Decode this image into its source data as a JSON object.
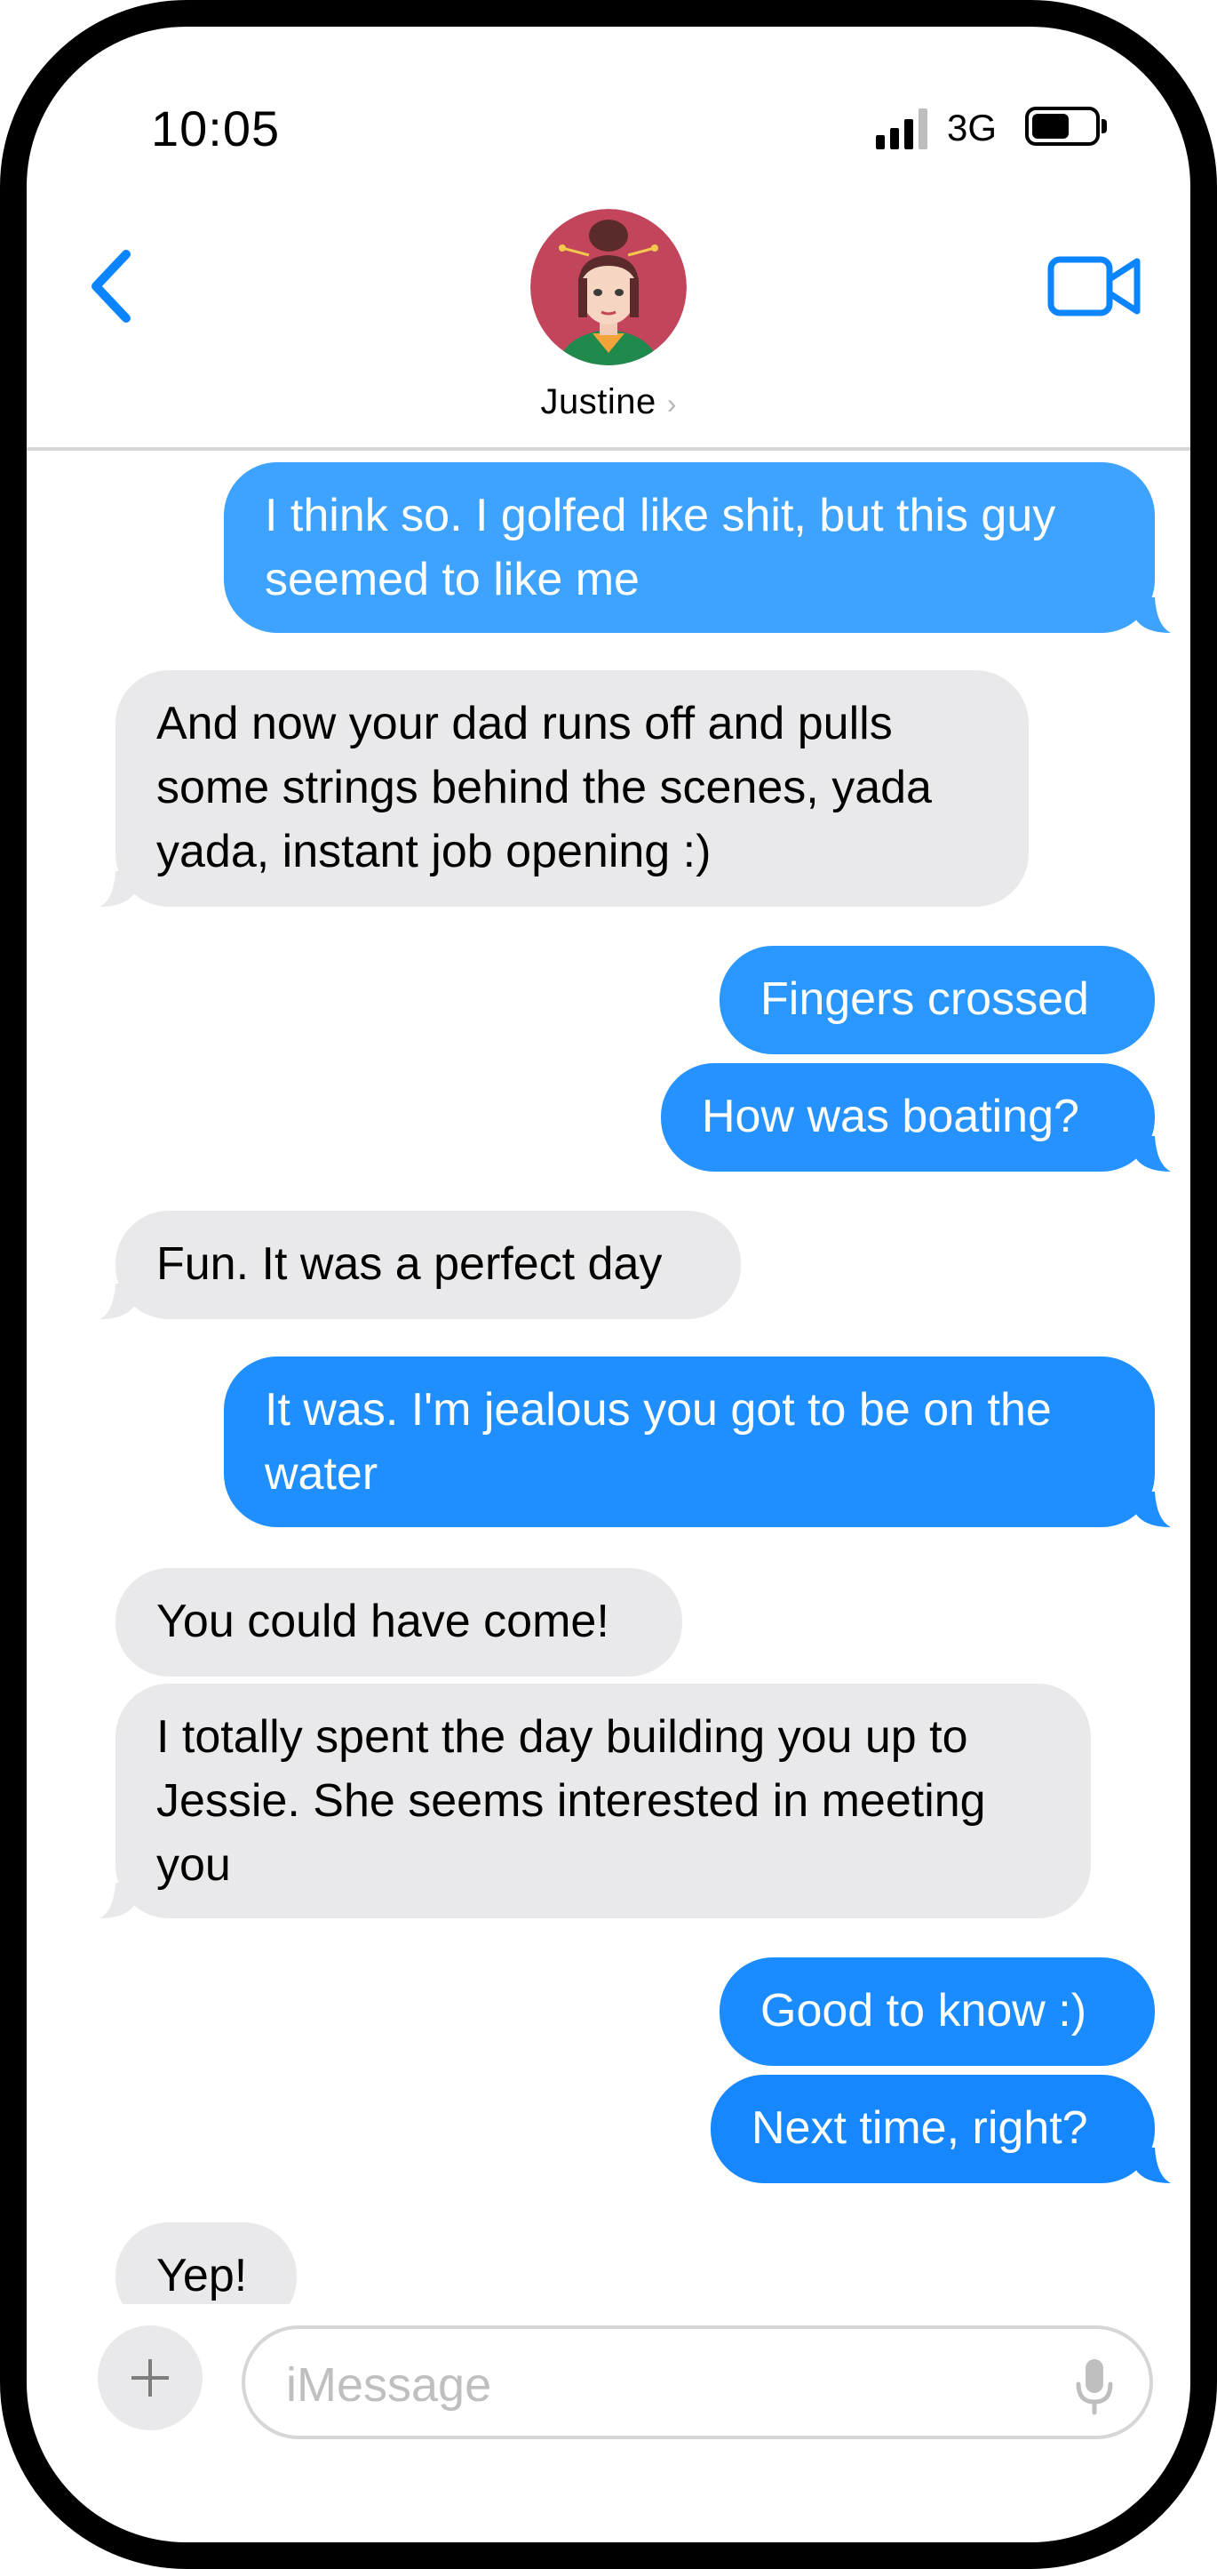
{
  "status_bar": {
    "time": "10:05",
    "network": "3G",
    "signal_bars": 4,
    "signal_active": 3,
    "battery_level": 0.6
  },
  "header": {
    "contact_name": "Justine",
    "name_chevron": "›"
  },
  "icons": {
    "back": "chevron-left-icon",
    "video": "video-camera-icon",
    "chevron": "chevron-right-icon",
    "plus": "plus-icon",
    "mic": "microphone-icon"
  },
  "colors": {
    "accent_blue": "#0a84ff",
    "sent_blue": "#1a8cff",
    "sent_blue_light": "#3ea2ff",
    "received_gray": "#e9e9eb"
  },
  "messages": [
    {
      "from": "me",
      "text": "I think so.  I golfed like shit, but this guy seemed to like me"
    },
    {
      "from": "them",
      "text": "And now your dad runs off and pulls some strings behind the scenes, yada yada, instant job opening :)"
    },
    {
      "from": "me",
      "text": "Fingers crossed"
    },
    {
      "from": "me",
      "text": "How was boating?"
    },
    {
      "from": "them",
      "text": "Fun.  It was a perfect day"
    },
    {
      "from": "me",
      "text": "It was.  I'm jealous you got to be on the water"
    },
    {
      "from": "them",
      "text": "You could have come!"
    },
    {
      "from": "them",
      "text": "I totally spent the day building you up to Jessie.  She seems interested in meeting you"
    },
    {
      "from": "me",
      "text": "Good to know :)"
    },
    {
      "from": "me",
      "text": "Next time, right?"
    },
    {
      "from": "them",
      "text": "Yep!"
    }
  ],
  "composer": {
    "placeholder": "iMessage"
  }
}
